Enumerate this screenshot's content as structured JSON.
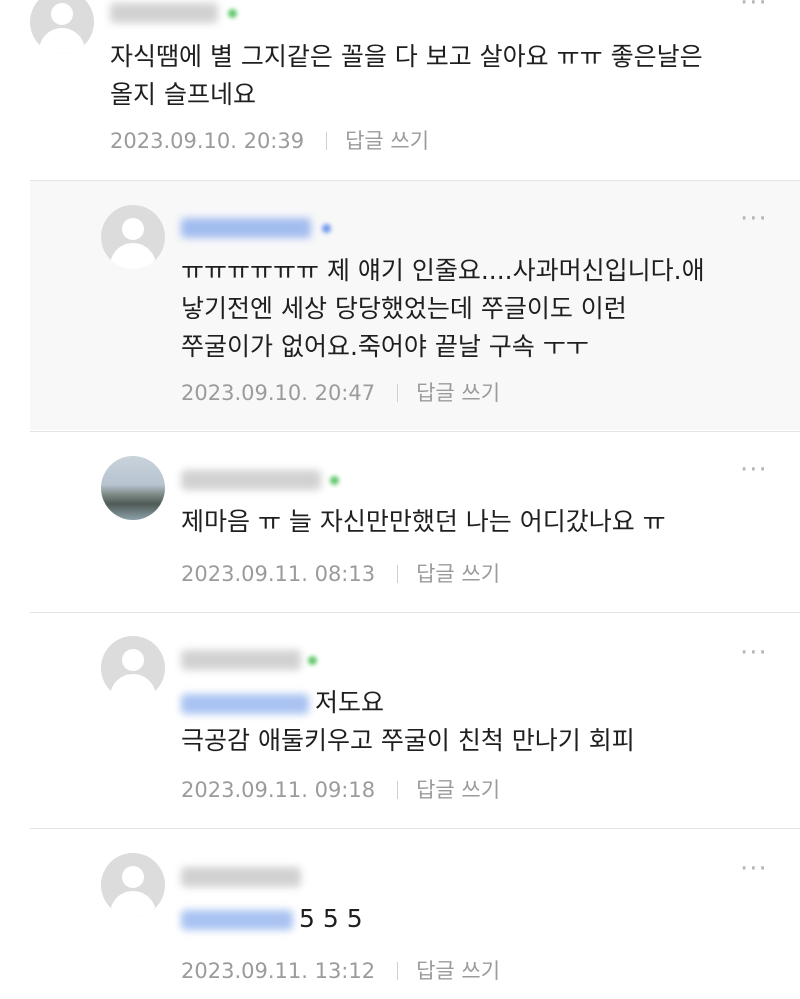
{
  "comments": [
    {
      "text_lines": [
        "자식땜에 별 그지같은 꼴을 다 보고 살아요 ㅠㅠ 좋은날은",
        "올지 슬프네요"
      ],
      "date": "2023.09.10. 20:39",
      "reply_label": "답글 쓰기"
    },
    {
      "text_lines": [
        "ㅠㅠㅠㅠㅠㅠ 제 얘기 인줄요....사과머신입니다.애",
        "낳기전엔 세상 당당했었는데 쭈글이도 이런",
        "쭈굴이가 없어요.죽어야 끝날 구속 ㅜㅜ"
      ],
      "date": "2023.09.10. 20:47",
      "reply_label": "답글 쓰기"
    },
    {
      "text_lines": [
        "제마음 ㅠ 늘 자신만만했던 나는 어디갔나요 ㅠ"
      ],
      "date": "2023.09.11. 08:13",
      "reply_label": "답글 쓰기"
    },
    {
      "mention_suffix": "저도요",
      "text_lines": [
        "극공감 애둘키우고 쭈굴이 친척 만나기 회피"
      ],
      "date": "2023.09.11. 09:18",
      "reply_label": "답글 쓰기"
    },
    {
      "mention_suffix": "5 5 5",
      "date": "2023.09.11. 13:12",
      "reply_label": "답글 쓰기"
    }
  ],
  "icons": {
    "avatar": "default-profile-icon",
    "more": "more-options-icon"
  }
}
